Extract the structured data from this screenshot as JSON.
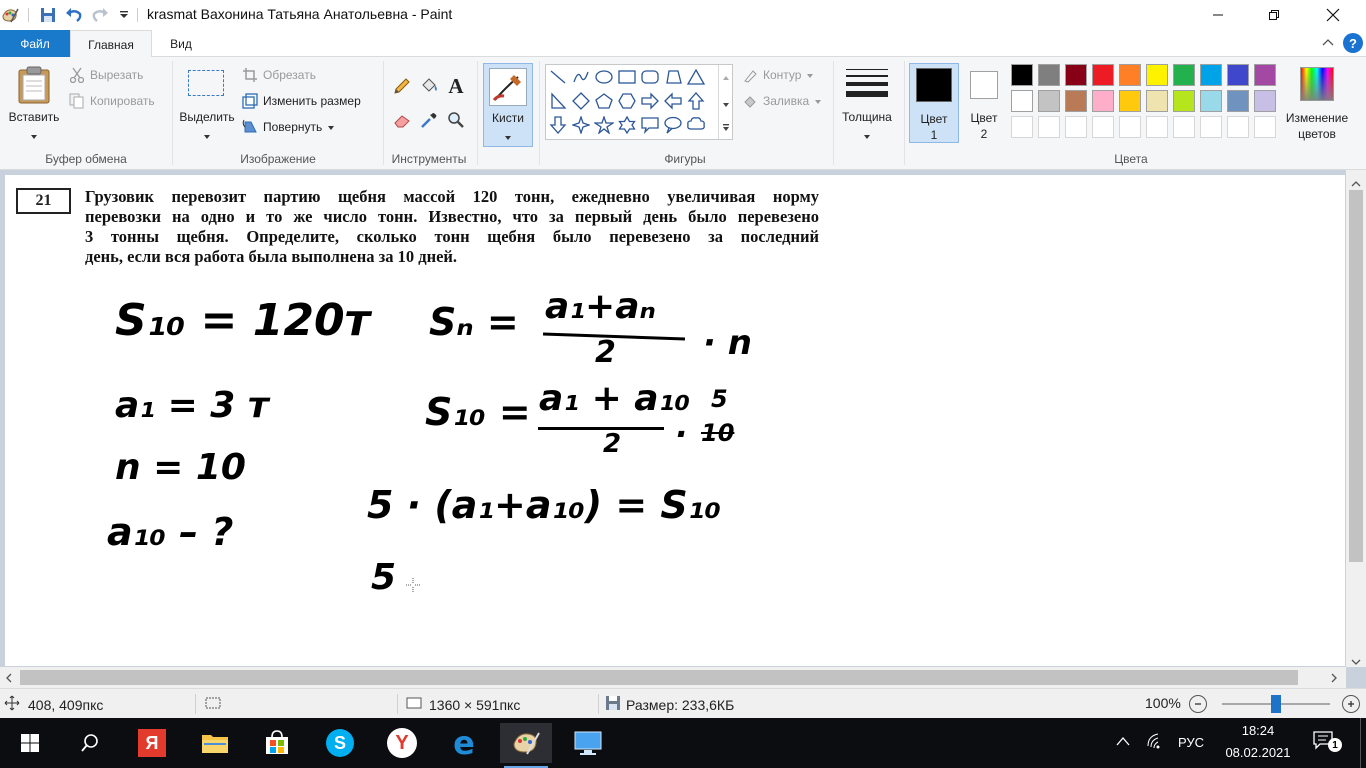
{
  "window": {
    "title": "krasmat Вахонина Татьяна Анатольевна - Paint"
  },
  "menu": {
    "file": "Файл",
    "home": "Главная",
    "view": "Вид"
  },
  "ribbon": {
    "clipboard": {
      "label": "Буфер обмена",
      "paste": "Вставить",
      "cut": "Вырезать",
      "copy": "Копировать"
    },
    "image": {
      "label": "Изображение",
      "select": "Выделить",
      "crop": "Обрезать",
      "resize": "Изменить размер",
      "rotate": "Повернуть"
    },
    "tools": {
      "label": "Инструменты"
    },
    "brushes": {
      "label": "Кисти"
    },
    "shapes": {
      "label": "Фигуры",
      "outline": "Контур",
      "fill": "Заливка"
    },
    "size": {
      "label": "Толщина"
    },
    "colors": {
      "label": "Цвета",
      "color1_line1": "Цвет",
      "color1_line2": "1",
      "color2_line1": "Цвет",
      "color2_line2": "2",
      "edit_line1": "Изменение",
      "edit_line2": "цветов",
      "color1_value": "#000000",
      "color2_value": "#ffffff",
      "palette_row1": [
        "#000000",
        "#7f7f7f",
        "#880015",
        "#ed1c24",
        "#ff7f27",
        "#fff200",
        "#22b14c",
        "#00a2e8",
        "#3f48cc",
        "#a349a4"
      ],
      "palette_row2": [
        "#ffffff",
        "#c3c3c3",
        "#b97a57",
        "#ffaec9",
        "#ffc90e",
        "#efe4b0",
        "#b5e61d",
        "#99d9ea",
        "#7092be",
        "#c8bfe7"
      ]
    }
  },
  "canvas": {
    "problem_number": "21",
    "problem_lines": [
      "Грузовик перевозит партию щебня массой 120 тонн, ежедневно увеличивая норму",
      "перевозки на одно и то же число тонн. Известно, что за первый день было перевезено",
      "3 тонны щебня. Определите, сколько тонн щебня было перевезено за последний",
      "день, если вся работа была выполнена за 10 дней."
    ],
    "handwriting": {
      "s10_line": "S₁₀ = 120т",
      "a1_line": "a₁ = 3 т",
      "n_line": "n = 10",
      "a10_line": "a₁₀ – ?",
      "sn_left": "Sₙ =",
      "sn_num": "a₁+aₙ",
      "sn_den": "2",
      "sn_mult": "· n",
      "s10_left": "S₁₀ =",
      "s10_num": "a₁ + a₁₀",
      "s10_den": "2",
      "s10_mult": "·",
      "s10_frac_num": "5",
      "s10_frac_den": "10",
      "eq_line": "5 · (a₁+a₁₀) = S₁₀",
      "last_line": "5"
    }
  },
  "status": {
    "cursor_pos": "408, 409пкс",
    "image_size": "1360 × 591пкс",
    "file_size": "Размер: 233,6КБ",
    "zoom": "100%",
    "zoom_fraction": 0.5
  },
  "taskbar": {
    "language": "РУС",
    "time": "18:24",
    "date": "08.02.2021",
    "notifications": "1"
  }
}
